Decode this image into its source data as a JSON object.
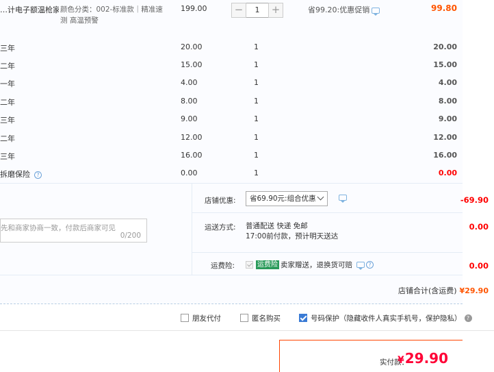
{
  "main_item": {
    "name": "…计电子额温枪家用…",
    "sku": "颜色分类：002-标准款｜精准速测 高温预警",
    "price": "199.00",
    "quantity": "1",
    "qty_minus": "−",
    "qty_plus": "+",
    "promo": "省99.20:优惠促销",
    "total": "99.80"
  },
  "services": [
    {
      "name": "三年",
      "price": "20.00",
      "qty": "1",
      "total": "20.00"
    },
    {
      "name": "二年",
      "price": "15.00",
      "qty": "1",
      "total": "15.00"
    },
    {
      "name": "一年",
      "price": "4.00",
      "qty": "1",
      "total": "4.00"
    },
    {
      "name": "二年",
      "price": "8.00",
      "qty": "1",
      "total": "8.00"
    },
    {
      "name": "三年",
      "price": "9.00",
      "qty": "1",
      "total": "9.00"
    },
    {
      "name": "二年",
      "price": "12.00",
      "qty": "1",
      "total": "12.00"
    },
    {
      "name": "三年",
      "price": "16.00",
      "qty": "1",
      "total": "16.00"
    },
    {
      "name": "拆磨保险",
      "price": "0.00",
      "qty": "1",
      "total": "0.00",
      "help": "?"
    }
  ],
  "store_discount": {
    "label": "店铺优惠:",
    "selected": "省69.90元:组合优惠",
    "value": "-69.90"
  },
  "message": {
    "placeholder": "先和商家协商一致，付款后商家可见",
    "count": "0/200"
  },
  "shipping": {
    "label": "运送方式:",
    "method": "普通配送 快递 免邮",
    "eta": "17:00前付款，预计明天送达",
    "value": "0.00"
  },
  "insurance": {
    "label": "运费险:",
    "badge": "运费险",
    "text": "卖家赠送，退换货可赔",
    "value": "0.00",
    "help": "?"
  },
  "store_total": {
    "label": "店铺合计(含运费)",
    "amount": "¥29.90"
  },
  "options": {
    "friend_pay": "朋友代付",
    "anonymous": "匿名购买",
    "number_protect": "号码保护（隐藏收件人真实手机号，保护隐私）",
    "tip": "?"
  },
  "payment": {
    "label": "实付款：",
    "yen": "¥",
    "amount": "29.90"
  },
  "colors": {
    "accent": "#ff5500",
    "price_red": "#ff0036",
    "checkbox_blue": "#3a7bd5"
  }
}
